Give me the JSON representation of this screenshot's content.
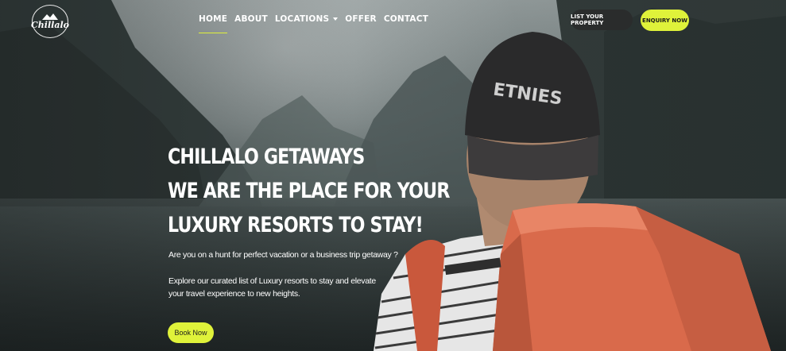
{
  "brand": {
    "logo_text": "Chillalo"
  },
  "nav": {
    "items": [
      {
        "label": "HOME",
        "active": true
      },
      {
        "label": "ABOUT"
      },
      {
        "label": "LOCATIONS",
        "dropdown": true
      },
      {
        "label": "OFFER"
      },
      {
        "label": "CONTACT"
      }
    ]
  },
  "header_actions": {
    "list_property": "LIST YOUR PROPERTY",
    "enquiry": "ENQUIRY NOW"
  },
  "hero": {
    "title_lines": [
      "CHILLALO GETAWAYS",
      "WE ARE THE PLACE FOR YOUR",
      "LUXURY RESORTS TO STAY!"
    ],
    "subtitle": "Are you on a hunt for perfect vacation or a business trip getaway ?",
    "description": "Explore our curated list of Luxury resorts to stay and elevate your travel experience to new heights.",
    "cta": "Book Now"
  },
  "colors": {
    "accent": "#dff23a",
    "dark_button": "#2a2c2c"
  }
}
